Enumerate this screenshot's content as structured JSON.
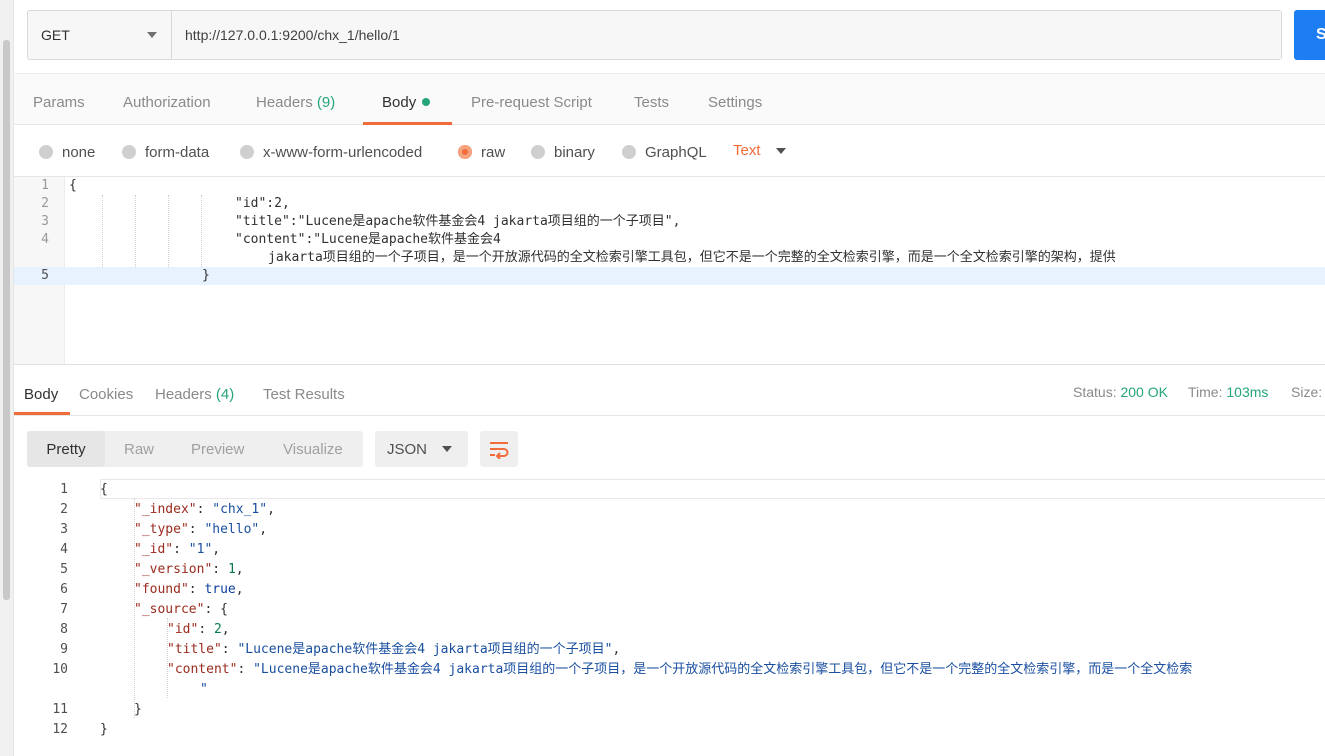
{
  "request": {
    "method": "GET",
    "url": "http://127.0.0.1:9200/chx_1/hello/1",
    "send_label": "S"
  },
  "request_tabs": [
    {
      "label": "Params"
    },
    {
      "label": "Authorization"
    },
    {
      "label": "Headers",
      "count": "(9)"
    },
    {
      "label": "Body",
      "active": true
    },
    {
      "label": "Pre-request Script"
    },
    {
      "label": "Tests"
    },
    {
      "label": "Settings"
    }
  ],
  "body_types": [
    {
      "label": "none"
    },
    {
      "label": "form-data"
    },
    {
      "label": "x-www-form-urlencoded"
    },
    {
      "label": "raw",
      "selected": true
    },
    {
      "label": "binary"
    },
    {
      "label": "GraphQL"
    }
  ],
  "raw_format": "Text",
  "request_body_lines": [
    {
      "num": "1",
      "text": "{"
    },
    {
      "num": "2",
      "text": "\"id\":2,"
    },
    {
      "num": "3",
      "text": "\"title\":\"Lucene是apache软件基金会4 jakarta项目组的一个子项目\","
    },
    {
      "num": "4",
      "text": "\"content\":\"Lucene是apache软件基金会4"
    },
    {
      "num": "",
      "text": "jakarta项目组的一个子项目，是一个开放源代码的全文检索引擎工具包，但它不是一个完整的全文检索引擎，而是一个全文检索引擎的架构，提供"
    },
    {
      "num": "5",
      "text": "}"
    }
  ],
  "response_tabs": [
    {
      "label": "Body",
      "active": true
    },
    {
      "label": "Cookies"
    },
    {
      "label": "Headers",
      "count": "(4)"
    },
    {
      "label": "Test Results"
    }
  ],
  "response_meta": {
    "status_label": "Status:",
    "status_value": "200 OK",
    "time_label": "Time:",
    "time_value": "103ms",
    "size_label": "Size:"
  },
  "view_modes": [
    {
      "label": "Pretty",
      "active": true
    },
    {
      "label": "Raw"
    },
    {
      "label": "Preview"
    },
    {
      "label": "Visualize"
    }
  ],
  "response_format": "JSON",
  "response_lines": {
    "n1": "1",
    "n2": "2",
    "n3": "3",
    "n4": "4",
    "n5": "5",
    "n6": "6",
    "n7": "7",
    "n8": "8",
    "n9": "9",
    "n10": "10",
    "n11": "11",
    "n12": "12",
    "open_brace": "{",
    "index_key": "\"_index\"",
    "index_val": "\"chx_1\"",
    "type_key": "\"_type\"",
    "type_val": "\"hello\"",
    "id_key": "\"_id\"",
    "id_val": "\"1\"",
    "version_key": "\"_version\"",
    "version_val": "1",
    "found_key": "\"found\"",
    "found_val": "true",
    "source_key": "\"_source\"",
    "src_id_key": "\"id\"",
    "src_id_val": "2",
    "src_title_key": "\"title\"",
    "src_title_val": "\"Lucene是apache软件基金会4 jakarta项目组的一个子项目\"",
    "src_content_key": "\"content\"",
    "src_content_val": "\"Lucene是apache软件基金会4 jakarta项目组的一个子项目，是一个开放源代码的全文检索引擎工具包，但它不是一个完整的全文检索引擎，而是一个全文检索",
    "src_content_end": "\"",
    "close_source": "}",
    "close_brace": "}"
  }
}
